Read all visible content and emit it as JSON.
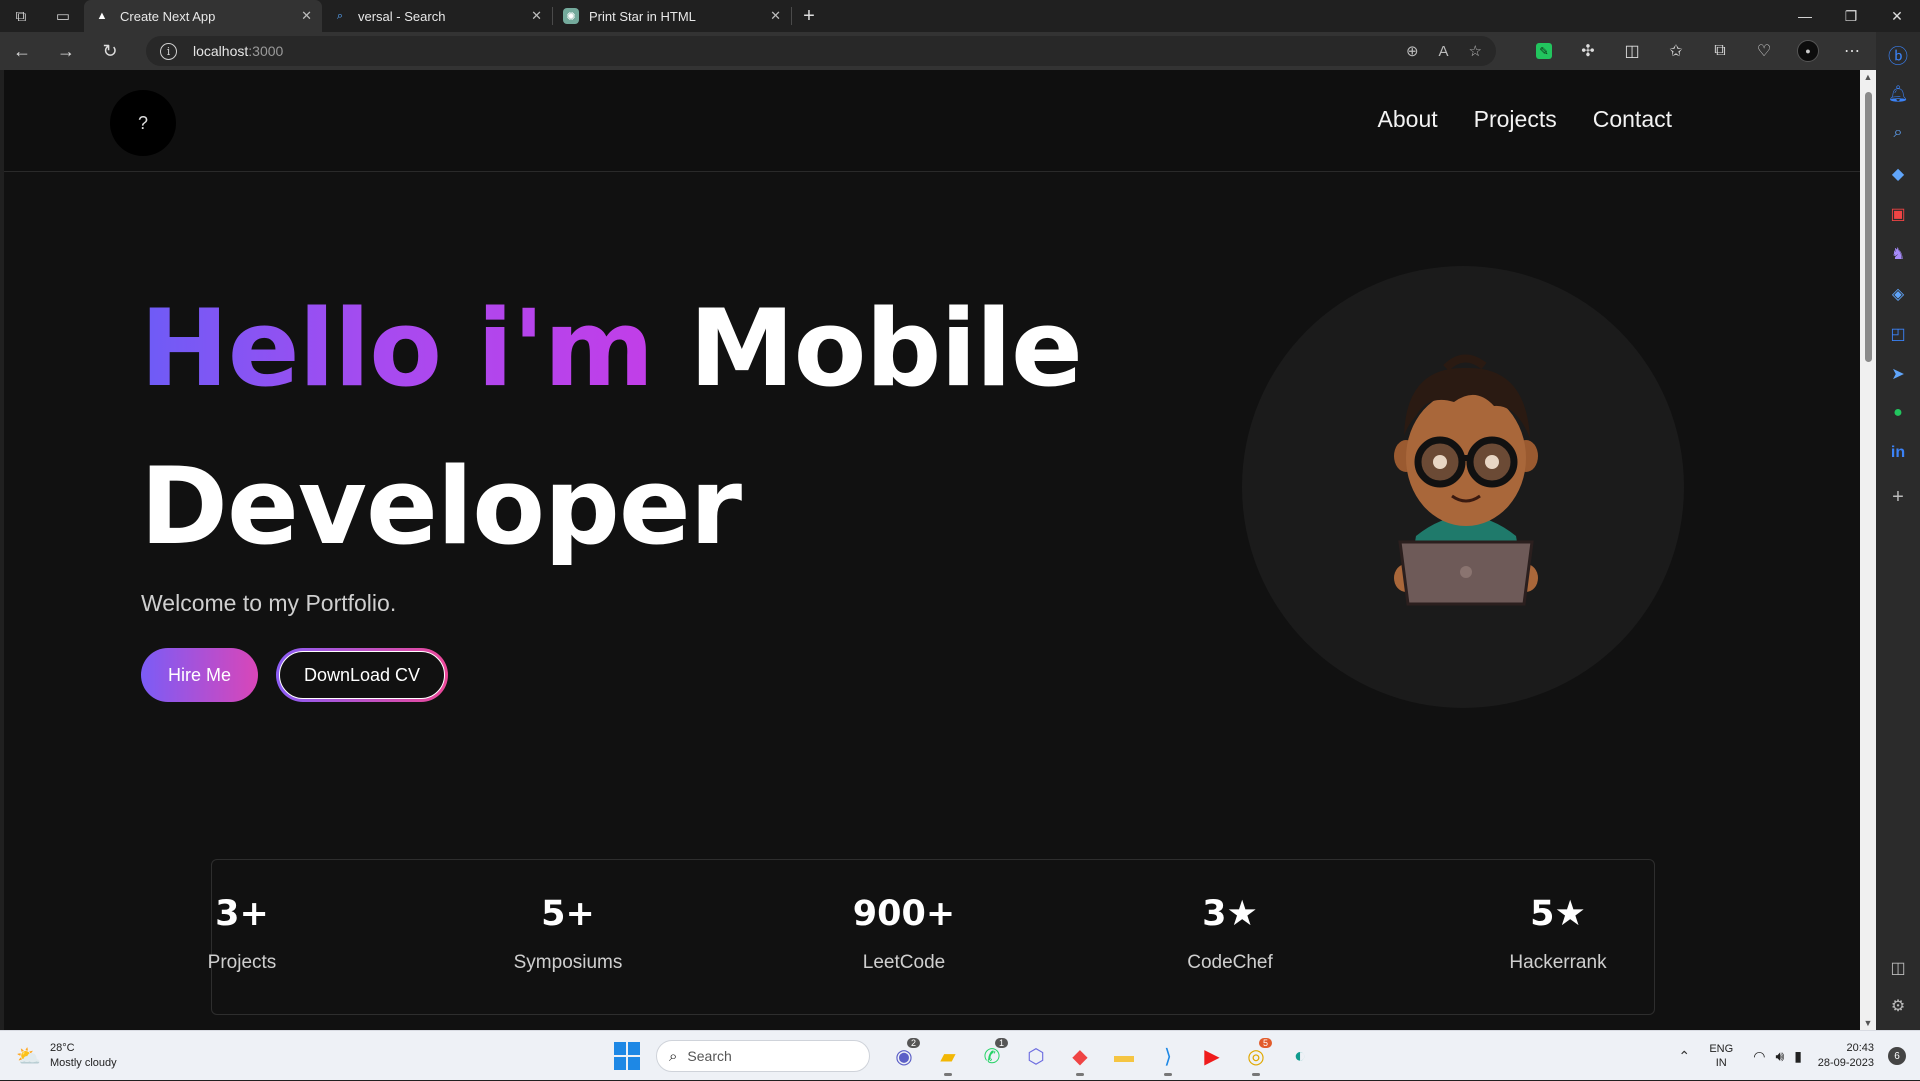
{
  "browser": {
    "tabs": [
      {
        "title": "Create Next App",
        "active": true
      },
      {
        "title": "versal - Search",
        "active": false
      },
      {
        "title": "Print Star in HTML",
        "active": false
      }
    ],
    "address": {
      "host": "localhost",
      "port": ":3000"
    }
  },
  "site": {
    "logo_text": "?",
    "nav": [
      {
        "label": "About"
      },
      {
        "label": "Projects"
      },
      {
        "label": "Contact"
      }
    ],
    "hero": {
      "greeting": "Hello i'm",
      "role_line1": "Mobile",
      "role_line2": "Developer",
      "subtitle": "Welcome to my Portfolio.",
      "primary_button": "Hire Me",
      "secondary_button": "DownLoad CV"
    },
    "stats": [
      {
        "value": "3+",
        "label": "Projects"
      },
      {
        "value": "5+",
        "label": "Symposiums"
      },
      {
        "value": "900+",
        "label": "LeetCode"
      },
      {
        "value": "3★",
        "label": "CodeChef"
      },
      {
        "value": "5★",
        "label": "Hackerrank"
      }
    ]
  },
  "taskbar": {
    "weather": {
      "temp": "28°C",
      "condition": "Mostly cloudy"
    },
    "search_placeholder": "Search",
    "apps": [
      {
        "icon": "teams-icon",
        "badge": "2"
      },
      {
        "icon": "file-explorer-icon",
        "badge": ""
      },
      {
        "icon": "whatsapp-icon",
        "badge": "1"
      },
      {
        "icon": "copilot-icon",
        "badge": ""
      },
      {
        "icon": "anydesk-icon",
        "badge": ""
      },
      {
        "icon": "folder-icon",
        "badge": ""
      },
      {
        "icon": "vscode-icon",
        "badge": ""
      },
      {
        "icon": "youtube-icon",
        "badge": ""
      },
      {
        "icon": "chrome-icon",
        "badge": "5"
      },
      {
        "icon": "edge-icon",
        "badge": ""
      }
    ],
    "lang_line1": "ENG",
    "lang_line2": "IN",
    "time": "20:43",
    "date": "28-09-2023",
    "notifications": "6"
  }
}
